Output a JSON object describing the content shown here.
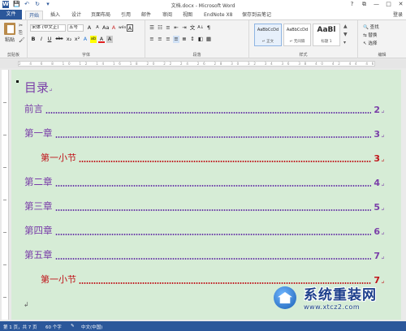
{
  "window": {
    "title": "文档.docx - Microsoft Word",
    "help": "?",
    "ribbon_opts": "⧉",
    "minimize": "—",
    "maximize": "□",
    "close": "✕"
  },
  "qat": {
    "word_icon": "W",
    "save": "💾",
    "undo": "↶",
    "redo": "↻",
    "customize": "▾"
  },
  "tabs": [
    {
      "label": "文件"
    },
    {
      "label": "开始"
    },
    {
      "label": "插入"
    },
    {
      "label": "设计"
    },
    {
      "label": "页面布局"
    },
    {
      "label": "引用"
    },
    {
      "label": "邮件"
    },
    {
      "label": "审阅"
    },
    {
      "label": "视图"
    },
    {
      "label": "EndNote X8"
    },
    {
      "label": "保存到云笔记"
    }
  ],
  "login": "登录",
  "ribbon": {
    "clipboard": {
      "paste": "粘贴",
      "label": "剪贴板",
      "cut": "✂",
      "copy": "⎘",
      "painter": "🖌"
    },
    "font": {
      "font_name": "宋体 (中文正)",
      "font_size": "五号",
      "label": "字体",
      "row1": [
        "A",
        "A",
        "Aa",
        "A",
        "wén",
        "A"
      ],
      "row2": [
        "B",
        "I",
        "U",
        "abc",
        "x₂",
        "x²",
        "A",
        "ab",
        "A",
        "A"
      ]
    },
    "paragraph": {
      "label": "段落",
      "row1": [
        "☰",
        "☷",
        "≡",
        "⇤",
        "⇥",
        "文",
        "A↓",
        "¶"
      ],
      "row2": [
        "≡",
        "≡",
        "≡",
        "≡",
        "≣",
        "↕",
        "◧",
        "▦"
      ]
    },
    "styles": {
      "label": "样式",
      "items": [
        {
          "sample": "AaBbCcDd",
          "name": "↵ 正文"
        },
        {
          "sample": "AaBbCcDd",
          "name": "↵ 无间隔"
        },
        {
          "sample": "AaBl",
          "name": "标题 1"
        }
      ]
    },
    "editing": {
      "find": "查找",
      "replace": "替换",
      "select": "选择",
      "label": "编辑"
    }
  },
  "ruler_marks": "2 4 6 8 10 12 14 16 18 20 22 24 26 28 30 32 34 36 38 40 42 44 46 48",
  "document": {
    "heading": "目录",
    "pilcrow": "↵",
    "entries": [
      {
        "text": "前言",
        "page": "2",
        "level": 1
      },
      {
        "text": "第一章",
        "page": "3",
        "level": 1
      },
      {
        "text": "第一小节",
        "page": "3",
        "level": 2
      },
      {
        "text": "第二章",
        "page": "4",
        "level": 1
      },
      {
        "text": "第三章",
        "page": "5",
        "level": 1
      },
      {
        "text": "第四章",
        "page": "6",
        "level": 1
      },
      {
        "text": "第五章",
        "page": "7",
        "level": 1
      },
      {
        "text": "第一小节",
        "page": "7",
        "level": 2
      }
    ]
  },
  "status": {
    "page": "第 1 页，共 7 页",
    "words": "60 个字",
    "proof_icon": "✎",
    "language": "中文(中国)"
  },
  "watermark": {
    "title": "系统重装网",
    "url": "www.xtcz2.com"
  }
}
